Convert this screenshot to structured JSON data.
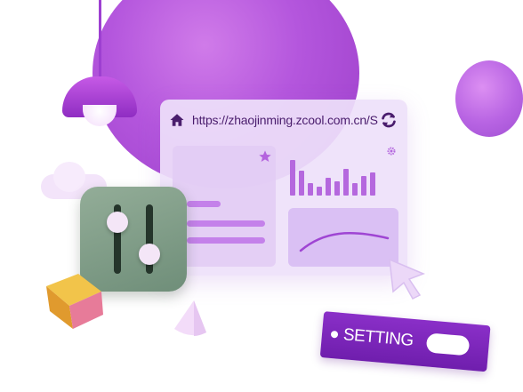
{
  "browser": {
    "url": "https://zhaojinming.zcool.com.cn/S"
  },
  "setting_bar": {
    "label": "SETTING"
  },
  "icons": [
    "home-icon",
    "refresh-icon",
    "star-icon",
    "gear-icon",
    "slider-icon",
    "cursor-icon"
  ],
  "colors": {
    "primary_purple": "#9b3ec9",
    "light_purple": "#ede1fa",
    "tile_green": "#7f9c86",
    "cube_yellow": "#eab43a",
    "cube_pink": "#e7789a"
  }
}
